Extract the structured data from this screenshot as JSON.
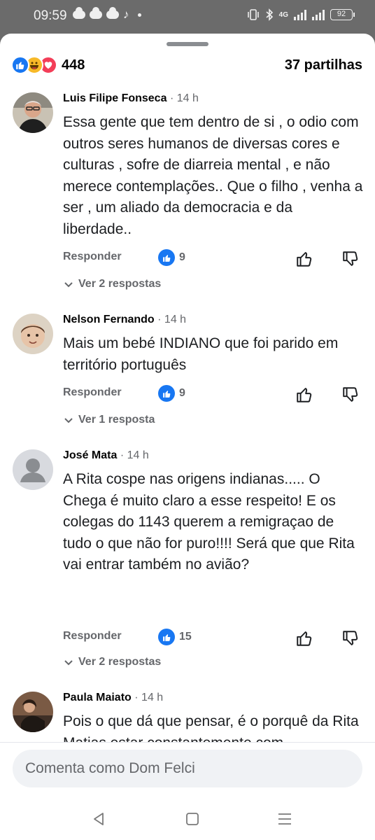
{
  "status_bar": {
    "time": "09:59",
    "notification_icons": [
      "cloud-icon",
      "cloud-icon",
      "cloud-icon",
      "tiktok-icon"
    ],
    "network": "4G",
    "battery": "92"
  },
  "post_stats": {
    "reaction_icons": [
      "like",
      "haha",
      "love"
    ],
    "reaction_count": "448",
    "shares": "37 partilhas"
  },
  "comments": [
    {
      "author": "Luis Filipe Fonseca",
      "time": "· 14 h",
      "text": "Essa gente que tem dentro de si , o odio com outros seres humanos de diversas cores e culturas , sofre de diarreia mental , e não merece contemplações.. Que o filho , venha a ser ,  um aliado da democracia e da liberdade..",
      "reply_label": "Responder",
      "likes": "9",
      "view_replies": "Ver 2 respostas"
    },
    {
      "author": "Nelson Fernando",
      "time": "· 14 h",
      "text": "Mais um bebé INDIANO que foi parido em território português",
      "reply_label": "Responder",
      "likes": "9",
      "view_replies": "Ver 1 resposta"
    },
    {
      "author": "José Mata",
      "time": "· 14 h",
      "text": "A Rita cospe nas origens indianas..... O Chega é muito claro a esse respeito! E os colegas do 1143 querem a remigraçao de tudo o que não for puro!!!! Será que que Rita vai entrar também no avião?",
      "reply_label": "Responder",
      "likes": "15",
      "view_replies": "Ver 2 respostas"
    },
    {
      "author": "Paula Maiato",
      "time": "· 14 h",
      "text": "Pois o que dá que pensar, é o porquê da Rita Matias estar constantemente com"
    }
  ],
  "composer": {
    "placeholder": "Comenta como Dom Felci"
  },
  "colors": {
    "accent": "#1877f2",
    "secondary_text": "#65676b",
    "status_bar_bg": "#6b6b6b"
  }
}
